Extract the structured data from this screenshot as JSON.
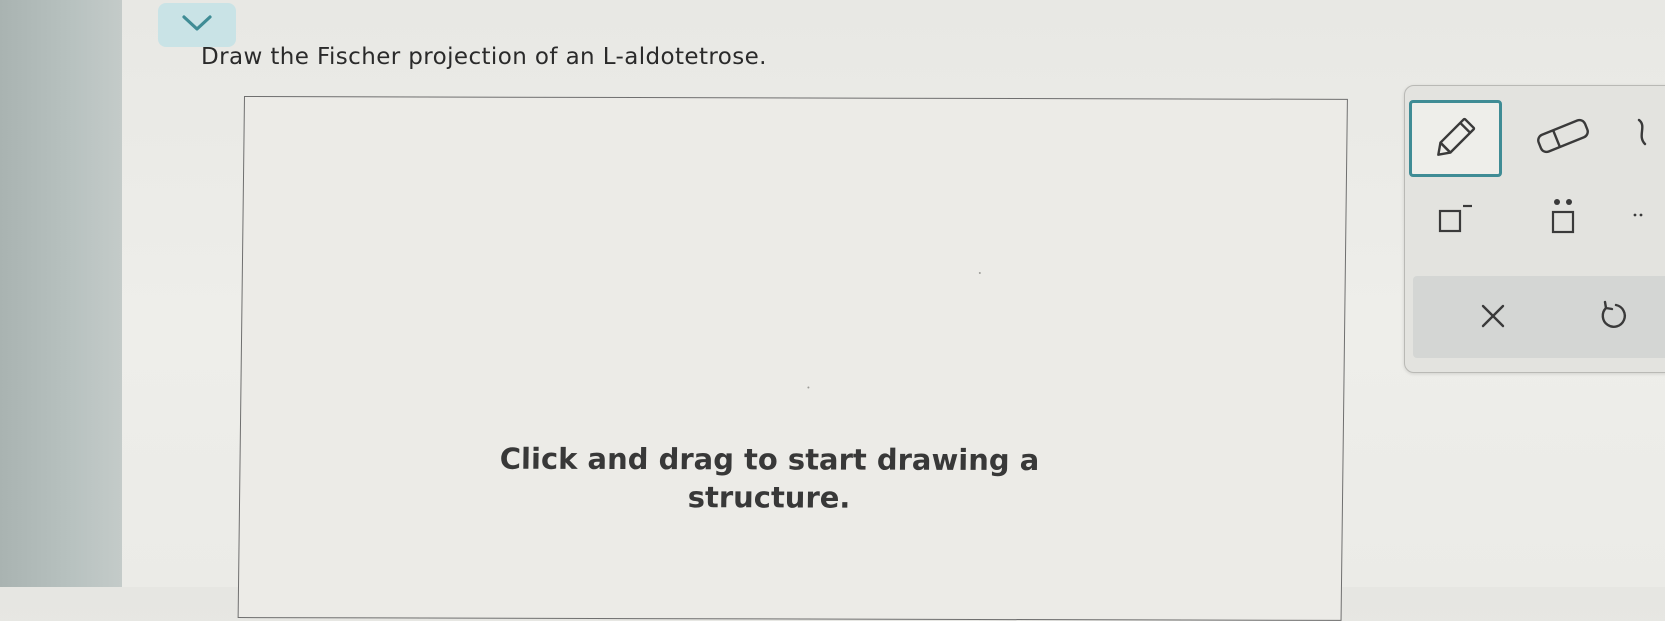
{
  "question": {
    "text": "Draw the Fischer projection of an L-aldotetrose."
  },
  "canvas": {
    "prompt_line1": "Click and drag to start drawing a",
    "prompt_line2": "structure."
  },
  "toolbar": {
    "tools": [
      {
        "name": "pencil",
        "icon": "pencil-icon",
        "selected": true
      },
      {
        "name": "eraser",
        "icon": "eraser-icon",
        "selected": false
      },
      {
        "name": "charge",
        "icon": "negative-charge-icon",
        "selected": false
      },
      {
        "name": "lone-pair",
        "icon": "lone-pair-icon",
        "selected": false
      }
    ],
    "actions": [
      {
        "name": "clear",
        "icon": "close-icon"
      },
      {
        "name": "undo",
        "icon": "undo-icon"
      }
    ]
  },
  "colors": {
    "accent": "#3f8c95",
    "collapse_bg": "#c9e3e6"
  }
}
